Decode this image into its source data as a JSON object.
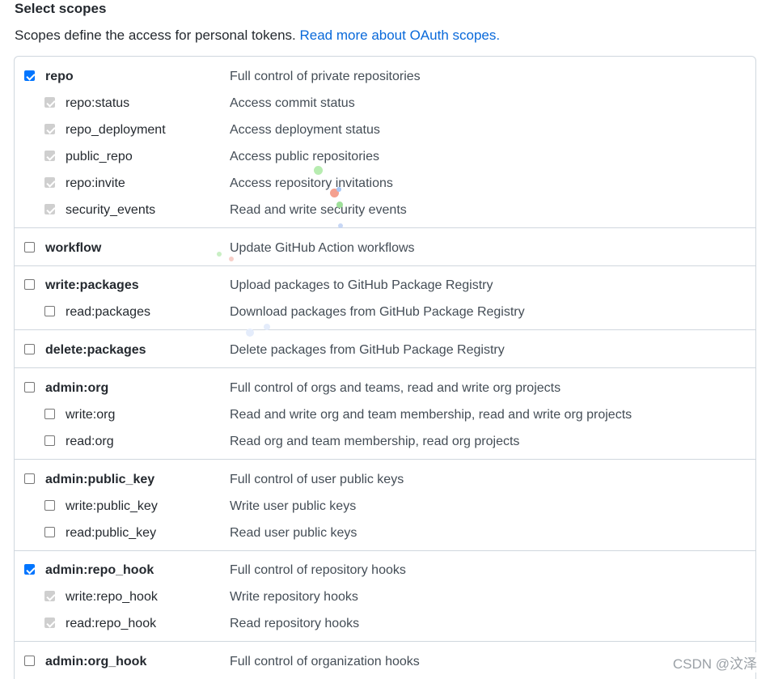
{
  "header": {
    "title": "Select scopes",
    "description": "Scopes define the access for personal tokens.",
    "link": "Read more about OAuth scopes."
  },
  "scopes": [
    {
      "name": "repo",
      "desc": "Full control of private repositories",
      "state": "checked"
    },
    {
      "name": "repo:status",
      "desc": "Access commit status",
      "state": "disabled"
    },
    {
      "name": "repo_deployment",
      "desc": "Access deployment status",
      "state": "disabled"
    },
    {
      "name": "public_repo",
      "desc": "Access public repositories",
      "state": "disabled"
    },
    {
      "name": "repo:invite",
      "desc": "Access repository invitations",
      "state": "disabled"
    },
    {
      "name": "security_events",
      "desc": "Read and write security events",
      "state": "disabled"
    },
    {
      "name": "workflow",
      "desc": "Update GitHub Action workflows",
      "state": "unchecked"
    },
    {
      "name": "write:packages",
      "desc": "Upload packages to GitHub Package Registry",
      "state": "unchecked"
    },
    {
      "name": "read:packages",
      "desc": "Download packages from GitHub Package Registry",
      "state": "unchecked"
    },
    {
      "name": "delete:packages",
      "desc": "Delete packages from GitHub Package Registry",
      "state": "unchecked"
    },
    {
      "name": "admin:org",
      "desc": "Full control of orgs and teams, read and write org projects",
      "state": "unchecked"
    },
    {
      "name": "write:org",
      "desc": "Read and write org and team membership, read and write org projects",
      "state": "unchecked"
    },
    {
      "name": "read:org",
      "desc": "Read org and team membership, read org projects",
      "state": "unchecked"
    },
    {
      "name": "admin:public_key",
      "desc": "Full control of user public keys",
      "state": "unchecked"
    },
    {
      "name": "write:public_key",
      "desc": "Write user public keys",
      "state": "unchecked"
    },
    {
      "name": "read:public_key",
      "desc": "Read user public keys",
      "state": "unchecked"
    },
    {
      "name": "admin:repo_hook",
      "desc": "Full control of repository hooks",
      "state": "checked"
    },
    {
      "name": "write:repo_hook",
      "desc": "Write repository hooks",
      "state": "disabled"
    },
    {
      "name": "read:repo_hook",
      "desc": "Read repository hooks",
      "state": "disabled"
    },
    {
      "name": "admin:org_hook",
      "desc": "Full control of organization hooks",
      "state": "unchecked"
    }
  ],
  "watermark": "CSDN @汶泽",
  "colors": {
    "link": "#0969da",
    "checked": "#0075ff",
    "disabled": "#cfcfcf",
    "border": "#d0d7de"
  }
}
